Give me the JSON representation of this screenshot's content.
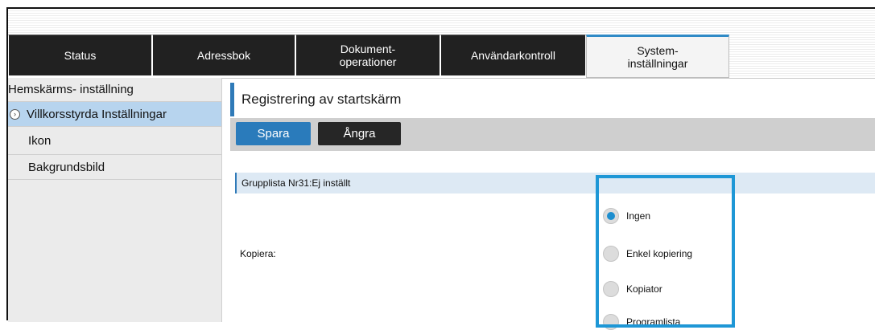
{
  "tabs": [
    {
      "label": "Status"
    },
    {
      "label": "Adressbok"
    },
    {
      "label": "Dokument-\noperationer"
    },
    {
      "label": "Användarkontroll"
    },
    {
      "label": "System-\ninställningar"
    }
  ],
  "sidebar": {
    "items": [
      {
        "label": "Hemskärms- inställning"
      },
      {
        "label": "Villkorsstyrda Inställningar"
      },
      {
        "label": "Ikon"
      },
      {
        "label": "Bakgrundsbild"
      }
    ]
  },
  "main": {
    "title": "Registrering av startskärm",
    "save_label": "Spara",
    "undo_label": "Ångra",
    "group_header": "Grupplista Nr31:Ej inställt",
    "field_label": "Kopiera:",
    "options": [
      {
        "label": "Ingen",
        "checked": true
      },
      {
        "label": "Enkel kopiering",
        "checked": false
      },
      {
        "label": "Kopiator",
        "checked": false
      },
      {
        "label": "Programlista",
        "checked": false
      }
    ]
  },
  "colors": {
    "accent": "#2a7bbb",
    "highlight": "#1e97d6",
    "active_sidebar": "#b7d4ee",
    "tab_dark": "#212121"
  }
}
